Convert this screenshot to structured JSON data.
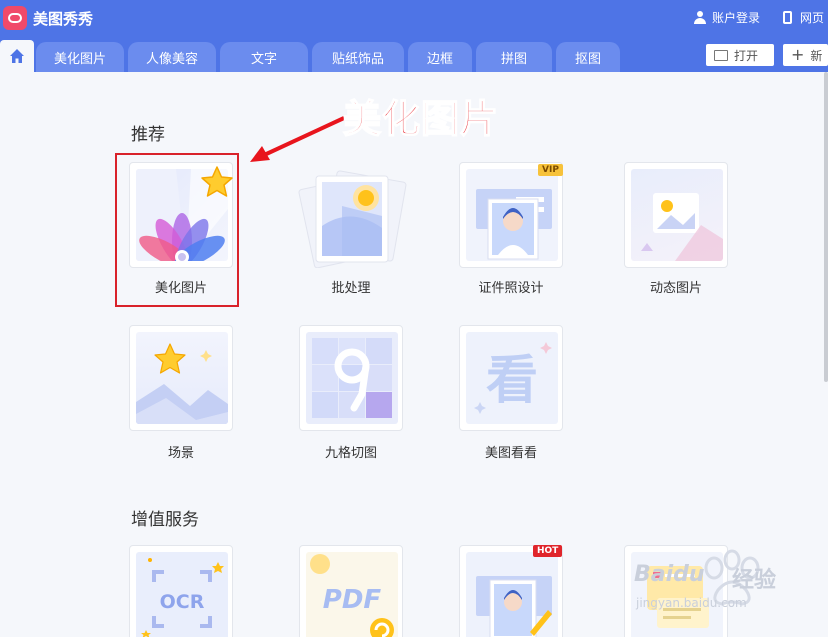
{
  "app": {
    "name": "美图秀秀"
  },
  "titlebar": {
    "login_label": "账户登录",
    "mobile_label": "网页"
  },
  "tabs": [
    {
      "label": "美化图片"
    },
    {
      "label": "人像美容"
    },
    {
      "label": "文字"
    },
    {
      "label": "贴纸饰品"
    },
    {
      "label": "边框"
    },
    {
      "label": "拼图"
    },
    {
      "label": "抠图"
    }
  ],
  "toolbar": {
    "open_label": "打开",
    "new_label": "新"
  },
  "sections": {
    "recommend": {
      "title": "推荐",
      "items": [
        {
          "label": "美化图片",
          "icon": "beautify-icon"
        },
        {
          "label": "批处理",
          "icon": "batch-icon"
        },
        {
          "label": "证件照设计",
          "icon": "id-photo-icon",
          "badge": "VIP"
        },
        {
          "label": "动态图片",
          "icon": "dynamic-image-icon"
        },
        {
          "label": "场景",
          "icon": "scene-icon"
        },
        {
          "label": "九格切图",
          "icon": "nine-grid-icon"
        },
        {
          "label": "美图看看",
          "icon": "viewer-icon"
        }
      ]
    },
    "services": {
      "title": "增值服务",
      "items": [
        {
          "label": "OCR",
          "icon": "ocr-icon"
        },
        {
          "label": "PDF",
          "icon": "pdf-icon"
        },
        {
          "label": "",
          "icon": "id-photo-edit-icon",
          "badge": "HOT"
        },
        {
          "label": "",
          "icon": "notes-icon"
        }
      ]
    }
  },
  "annotation": {
    "text": "美化图片"
  },
  "watermark": {
    "brand": "Baidu",
    "brand_cn": "经验",
    "url": "jingyan.baidu.com"
  },
  "colors": {
    "titlebar": "#4e74e6",
    "tab": "#6b8cee",
    "annotation_red": "#e8151d",
    "vip": "#f7c23a",
    "hot": "#e0252b"
  }
}
